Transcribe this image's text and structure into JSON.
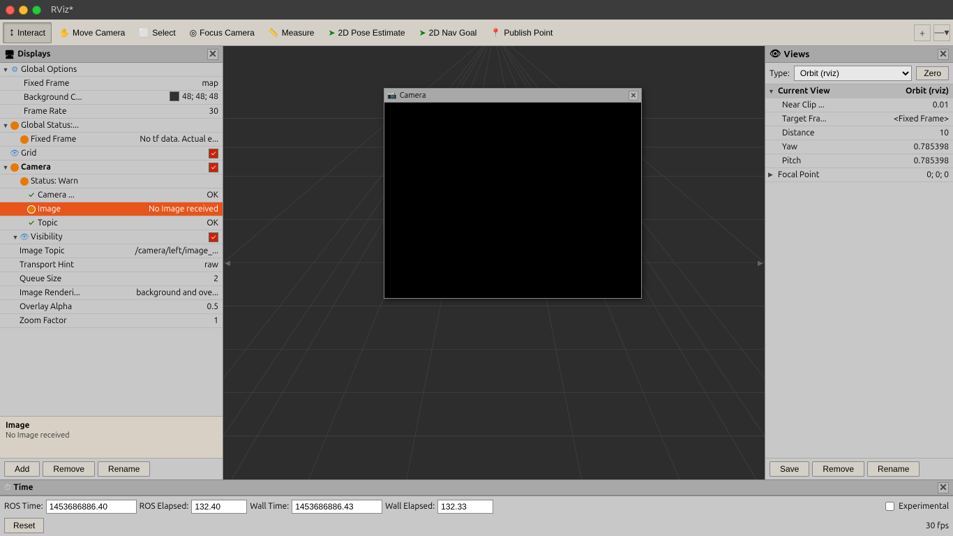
{
  "titlebar": {
    "title": "RViz*"
  },
  "toolbar": {
    "interact_label": "Interact",
    "move_camera_label": "Move Camera",
    "select_label": "Select",
    "focus_camera_label": "Focus Camera",
    "measure_label": "Measure",
    "pose_estimate_label": "2D Pose Estimate",
    "nav_goal_label": "2D Nav Goal",
    "publish_point_label": "Publish Point"
  },
  "displays_panel": {
    "title": "Displays",
    "items": [
      {
        "id": "global-options",
        "indent": 0,
        "arrow": "▼",
        "icon": "⚙",
        "icon_color": "#4488cc",
        "label": "Global Options",
        "value": ""
      },
      {
        "id": "fixed-frame",
        "indent": 1,
        "arrow": "",
        "icon": "",
        "label": "Fixed Frame",
        "value": "map"
      },
      {
        "id": "background-color",
        "indent": 1,
        "arrow": "",
        "icon": "",
        "label": "Background C...",
        "value": "swatch",
        "swatch_color": "#303030"
      },
      {
        "id": "frame-rate",
        "indent": 1,
        "arrow": "",
        "icon": "",
        "label": "Frame Rate",
        "value": "30"
      },
      {
        "id": "global-status",
        "indent": 0,
        "arrow": "▼",
        "icon": "◉",
        "icon_color": "#e87800",
        "label": "Global Status:...",
        "value": ""
      },
      {
        "id": "fixed-frame-status",
        "indent": 1,
        "arrow": "",
        "icon": "◉",
        "icon_color": "#e87800",
        "label": "Fixed Frame",
        "value": "No tf data.  Actual e..."
      },
      {
        "id": "grid",
        "indent": 0,
        "arrow": "",
        "icon": "👁",
        "icon_color": "#4488cc",
        "label": "Grid",
        "value": "checkbox"
      },
      {
        "id": "camera",
        "indent": 0,
        "arrow": "▼",
        "icon": "◉",
        "icon_color": "#e87800",
        "label": "Camera",
        "value": "checkbox"
      },
      {
        "id": "status-warn",
        "indent": 1,
        "arrow": "",
        "icon": "◉",
        "icon_color": "#e87800",
        "label": "Status: Warn",
        "value": ""
      },
      {
        "id": "camera-check",
        "indent": 2,
        "arrow": "",
        "icon": "✓",
        "icon_color": "#007000",
        "label": "Camera ...",
        "value": "OK"
      },
      {
        "id": "image-row",
        "indent": 2,
        "arrow": "",
        "icon": "◉",
        "icon_color": "#e87800",
        "label": "Image",
        "value": "No Image received",
        "selected": true
      },
      {
        "id": "topic-row",
        "indent": 2,
        "arrow": "",
        "icon": "✓",
        "icon_color": "#007000",
        "label": "Topic",
        "value": "OK"
      },
      {
        "id": "visibility-row",
        "indent": 2,
        "arrow": "▼",
        "icon": "👁",
        "icon_color": "#4488cc",
        "label": "Visibility",
        "value": "checkbox"
      },
      {
        "id": "image-topic",
        "indent": 1,
        "arrow": "",
        "icon": "",
        "label": "Image Topic",
        "value": "/camera/left/image_..."
      },
      {
        "id": "transport-hint",
        "indent": 1,
        "arrow": "",
        "icon": "",
        "label": "Transport Hint",
        "value": "raw"
      },
      {
        "id": "queue-size",
        "indent": 1,
        "arrow": "",
        "icon": "",
        "label": "Queue Size",
        "value": "2"
      },
      {
        "id": "image-render",
        "indent": 1,
        "arrow": "",
        "icon": "",
        "label": "Image Renderi...",
        "value": "background and ove..."
      },
      {
        "id": "overlay-alpha",
        "indent": 1,
        "arrow": "",
        "icon": "",
        "label": "Overlay Alpha",
        "value": "0.5"
      },
      {
        "id": "zoom-factor",
        "indent": 1,
        "arrow": "",
        "icon": "",
        "label": "Zoom Factor",
        "value": "1"
      }
    ],
    "info": {
      "title": "Image",
      "text": "No Image received"
    },
    "buttons": {
      "add": "Add",
      "remove": "Remove",
      "rename": "Rename"
    }
  },
  "camera_window": {
    "title": "Camera"
  },
  "views_panel": {
    "title": "Views",
    "type_label": "Type:",
    "type_value": "Orbit (rviz)",
    "zero_label": "Zero",
    "items": [
      {
        "id": "current-view",
        "arrow": "▼",
        "label": "Current View",
        "value": "Orbit (rviz)",
        "bold": true
      },
      {
        "id": "near-clip",
        "arrow": "",
        "label": "Near Clip ...",
        "value": "0.01"
      },
      {
        "id": "target-frame",
        "arrow": "",
        "label": "Target Fra...",
        "value": "<Fixed Frame>"
      },
      {
        "id": "distance",
        "arrow": "",
        "label": "Distance",
        "value": "10"
      },
      {
        "id": "yaw",
        "arrow": "",
        "label": "Yaw",
        "value": "0.785398"
      },
      {
        "id": "pitch",
        "arrow": "",
        "label": "Pitch",
        "value": "0.785398"
      },
      {
        "id": "focal-point",
        "arrow": "▶",
        "label": "Focal Point",
        "value": "0; 0; 0"
      }
    ],
    "buttons": {
      "save": "Save",
      "remove": "Remove",
      "rename": "Rename"
    }
  },
  "time_section": {
    "title": "Time",
    "ros_time_label": "ROS Time:",
    "ros_time_value": "1453686886.40",
    "ros_elapsed_label": "ROS Elapsed:",
    "ros_elapsed_value": "132.40",
    "wall_time_label": "Wall Time:",
    "wall_time_value": "1453686886.43",
    "wall_elapsed_label": "Wall Elapsed:",
    "wall_elapsed_value": "132.33",
    "experimental_label": "Experimental",
    "reset_label": "Reset",
    "fps_label": "30 fps"
  },
  "icons": {
    "displays_icon": "🖥",
    "views_icon": "👁",
    "time_icon": "⏱",
    "gear_icon": "⚙",
    "interact_icon": "↕",
    "move_camera_icon": "✋",
    "select_icon": "⬜",
    "focus_camera_icon": "◎",
    "measure_icon": "📏",
    "pose_icon": "➤",
    "nav_icon": "➤",
    "publish_icon": "📍",
    "plus_icon": "+",
    "minus_icon": "—"
  }
}
